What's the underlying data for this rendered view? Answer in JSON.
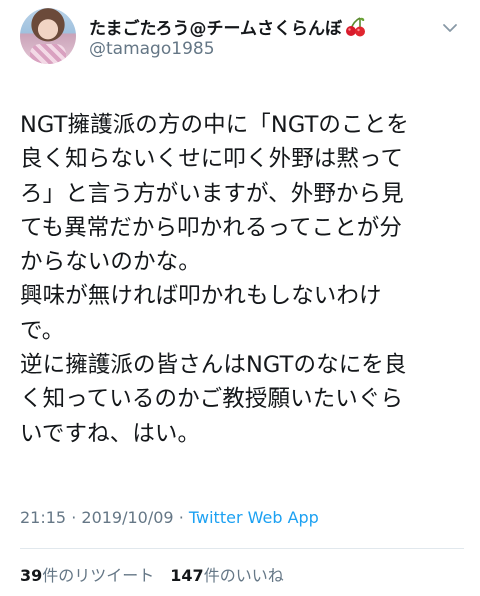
{
  "author": {
    "display_name": "たまごたろう@チームさくらんぼ",
    "emoji_icon": "cherries-icon",
    "handle": "@tamago1985"
  },
  "tweet": {
    "text": "NGT擁護派の方の中に「NGTのことを\n良く知らないくせに叩く外野は黙って\nろ」と言う方がいますが、外野から見\nても異常だから叩かれるってことが分\nからないのかな。\n興味が無ければ叩かれもしないわけ\nで。\n逆に擁護派の皆さんはNGTのなにを良\nく知っているのかご教授願いたいぐら\nいですね、はい。"
  },
  "meta": {
    "time": "21:15",
    "separator": "·",
    "date": "2019/10/09",
    "source_app": "Twitter Web App"
  },
  "stats": {
    "retweet_count": "39",
    "retweet_label": "件のリツイート",
    "like_count": "147",
    "like_label": "件のいいね"
  },
  "colors": {
    "text": "#14171a",
    "secondary": "#657786",
    "link": "#1da1f2",
    "divider": "#e1e8ed"
  }
}
